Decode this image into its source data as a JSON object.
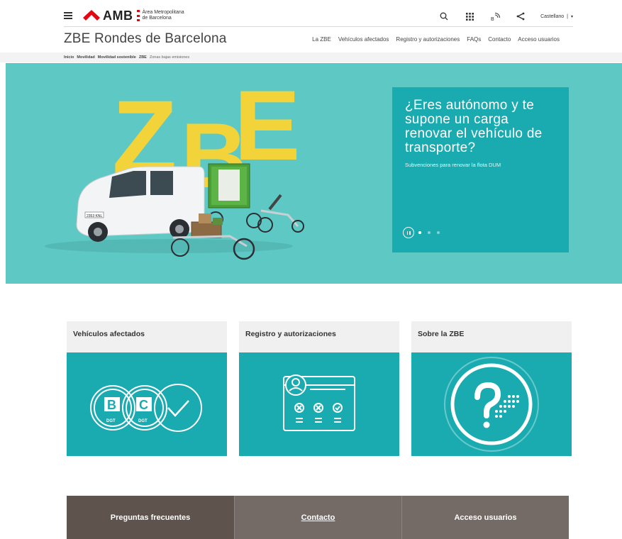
{
  "header": {
    "logo_text": "AMB",
    "logo_sub_line1": "Àrea Metropolitana",
    "logo_sub_line2": "de Barcelona",
    "language": "Castellano",
    "language_separator": "|",
    "icons": [
      "search-icon",
      "apps-grid-icon",
      "wifi-accessibility-icon",
      "share-icon"
    ]
  },
  "site": {
    "title": "ZBE Rondes de Barcelona"
  },
  "nav": {
    "items": [
      "La ZBE",
      "Vehículos afectados",
      "Registro y autorizaciones",
      "FAQs",
      "Contacto",
      "Acceso usuarios"
    ]
  },
  "breadcrumb": {
    "items": [
      "Inicio",
      "Movilidad",
      "Movilidad sostenible",
      "ZBE",
      "Zonas bajas emisiones"
    ]
  },
  "hero": {
    "letters": [
      "Z",
      "B",
      "E"
    ],
    "title": "¿Eres autónomo y te supone un carga renovar el vehículo de transporte?",
    "subtitle": "Subvenciones para renovar la flota DUM",
    "slides_count": 3,
    "active_slide": 1,
    "plate_text": "2353 KNL"
  },
  "cards": [
    {
      "title": "Vehículos afectados",
      "icon": "vehicle-labels-icon",
      "label_b": "B",
      "label_c": "C",
      "dgt": "DGT"
    },
    {
      "title": "Registro y autorizaciones",
      "icon": "registration-form-icon"
    },
    {
      "title": "Sobre la ZBE",
      "icon": "question-info-icon"
    }
  ],
  "bottom_links": [
    "Preguntas frecuentes",
    "Contacto",
    "Acceso usuarios"
  ],
  "colors": {
    "teal": "#1aabb0",
    "hero_bg": "#5ec9c4",
    "zbe_yellow": "#f3d33a",
    "brand_red": "#e30613",
    "brown_dark": "#5e534d",
    "brown": "#756b66"
  }
}
